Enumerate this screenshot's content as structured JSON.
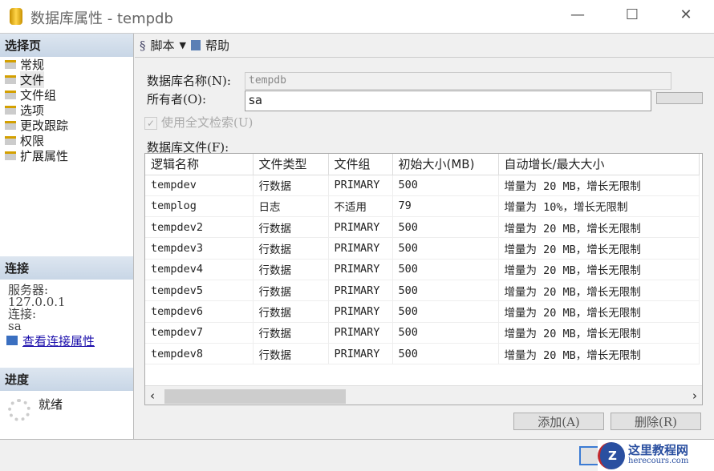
{
  "window": {
    "title": "数据库属性 - tempdb",
    "minimize": "—",
    "maximize": "☐",
    "close": "✕"
  },
  "sidebar": {
    "header": "选择页",
    "items": [
      "常规",
      "文件",
      "文件组",
      "选项",
      "更改跟踪",
      "权限",
      "扩展属性"
    ],
    "connection": {
      "header": "连接",
      "server_label": "服务器:",
      "server": "127.0.0.1",
      "conn_label": "连接:",
      "conn": "sa",
      "link": "查看连接属性"
    },
    "progress": {
      "header": "进度",
      "status": "就绪"
    }
  },
  "toolbar": {
    "script": "脚本",
    "help": "帮助"
  },
  "form": {
    "dbname_label": "数据库名称(N):",
    "dbname": "tempdb",
    "owner_label": "所有者(O):",
    "owner": "sa",
    "fulltext": "使用全文检索(U)",
    "files_label": "数据库文件(F):"
  },
  "table": {
    "headers": [
      "逻辑名称",
      "文件类型",
      "文件组",
      "初始大小(MB)",
      "自动增长/最大大小"
    ],
    "rows": [
      [
        "tempdev",
        "行数据",
        "PRIMARY",
        "500",
        "增量为 20 MB，增长无限制"
      ],
      [
        "templog",
        "日志",
        "不适用",
        "79",
        "增量为 10%，增长无限制"
      ],
      [
        "tempdev2",
        "行数据",
        "PRIMARY",
        "500",
        "增量为 20 MB，增长无限制"
      ],
      [
        "tempdev3",
        "行数据",
        "PRIMARY",
        "500",
        "增量为 20 MB，增长无限制"
      ],
      [
        "tempdev4",
        "行数据",
        "PRIMARY",
        "500",
        "增量为 20 MB，增长无限制"
      ],
      [
        "tempdev5",
        "行数据",
        "PRIMARY",
        "500",
        "增量为 20 MB，增长无限制"
      ],
      [
        "tempdev6",
        "行数据",
        "PRIMARY",
        "500",
        "增量为 20 MB，增长无限制"
      ],
      [
        "tempdev7",
        "行数据",
        "PRIMARY",
        "500",
        "增量为 20 MB，增长无限制"
      ],
      [
        "tempdev8",
        "行数据",
        "PRIMARY",
        "500",
        "增量为 20 MB，增长无限制"
      ]
    ]
  },
  "buttons": {
    "add": "添加(A)",
    "remove": "删除(R)"
  },
  "watermark": {
    "name": "这里教程网",
    "url": "herecours.com"
  }
}
